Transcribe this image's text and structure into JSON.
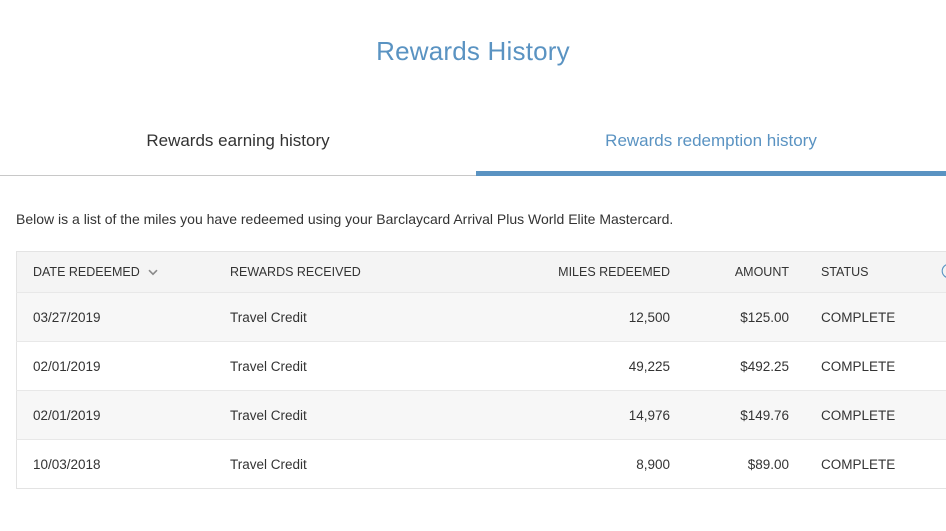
{
  "page": {
    "title": "Rewards History"
  },
  "tabs": [
    {
      "label": "Rewards earning history",
      "active": false
    },
    {
      "label": "Rewards redemption history",
      "active": true
    }
  ],
  "intro_text": "Below is a list of the miles you have redeemed using your Barclaycard Arrival Plus World Elite Mastercard.",
  "table": {
    "headers": {
      "date": "DATE REDEEMED",
      "reward": "REWARDS RECEIVED",
      "miles": "MILES REDEEMED",
      "amount": "AMOUNT",
      "status": "STATUS"
    },
    "sort_icon": "chevron-down-icon",
    "info_icon": "info-icon",
    "rows": [
      {
        "date": "03/27/2019",
        "reward": "Travel Credit",
        "miles": "12,500",
        "amount": "$125.00",
        "status": "COMPLETE"
      },
      {
        "date": "02/01/2019",
        "reward": "Travel Credit",
        "miles": "49,225",
        "amount": "$492.25",
        "status": "COMPLETE"
      },
      {
        "date": "02/01/2019",
        "reward": "Travel Credit",
        "miles": "14,976",
        "amount": "$149.76",
        "status": "COMPLETE"
      },
      {
        "date": "10/03/2018",
        "reward": "Travel Credit",
        "miles": "8,900",
        "amount": "$89.00",
        "status": "COMPLETE"
      }
    ]
  },
  "colors": {
    "accent": "#5a93c2",
    "text": "#333333",
    "header_bg": "#f4f4f4",
    "row_alt_bg": "#f7f7f7"
  }
}
